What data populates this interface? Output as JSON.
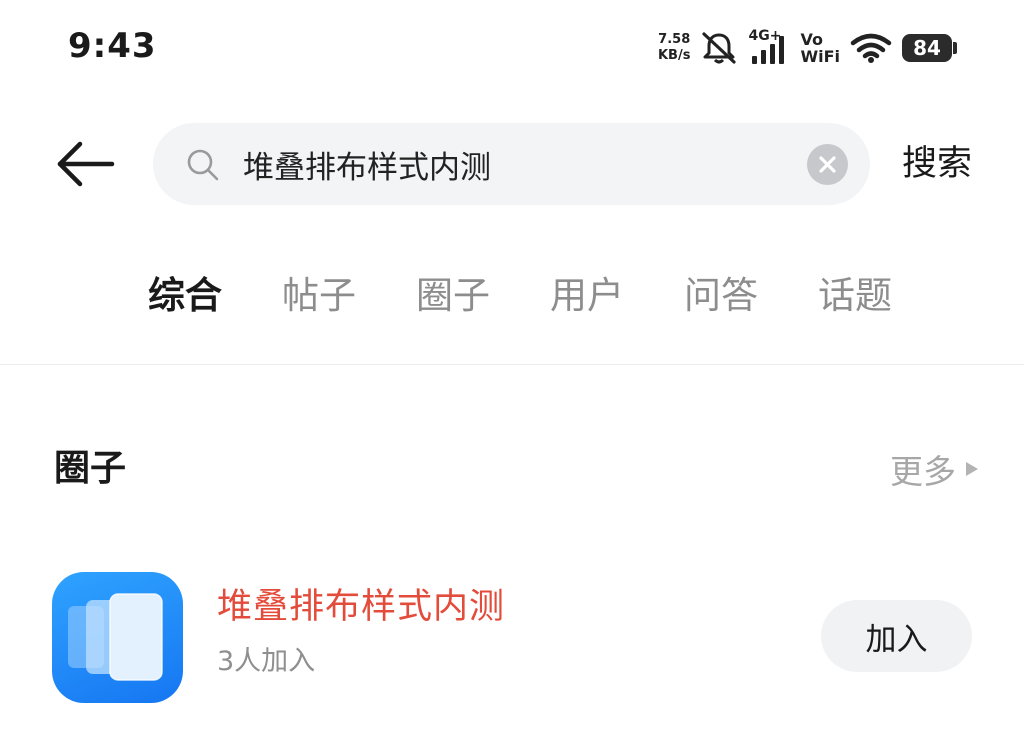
{
  "status_bar": {
    "time": "9:43",
    "net_speed_value": "7.58",
    "net_speed_unit": "KB/s",
    "mute_icon": "bell-muted-icon",
    "network_type": "4G+",
    "vowifi_top": "Vo",
    "vowifi_bottom": "WiFi",
    "battery_level": "84"
  },
  "search": {
    "query": "堆叠排布样式内测",
    "submit_label": "搜索"
  },
  "tabs": [
    {
      "label": "综合",
      "active": true
    },
    {
      "label": "帖子",
      "active": false
    },
    {
      "label": "圈子",
      "active": false
    },
    {
      "label": "用户",
      "active": false
    },
    {
      "label": "问答",
      "active": false
    },
    {
      "label": "话题",
      "active": false
    }
  ],
  "section": {
    "title": "圈子",
    "more_label": "更多"
  },
  "circle": {
    "name": "堆叠排布样式内测",
    "member_count": "3人加入",
    "join_label": "加入",
    "name_color": "#e34b3a",
    "avatar_color": "#1e88f5"
  }
}
